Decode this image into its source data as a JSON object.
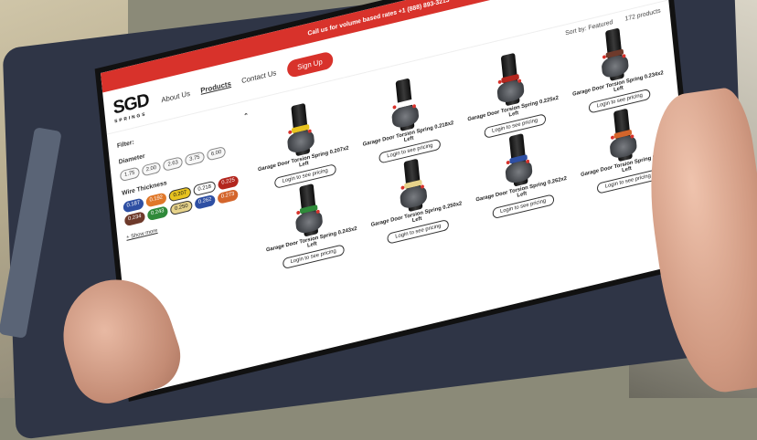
{
  "announcement": "Call us for volume based rates +1 (888) 893-3213 →",
  "brand": {
    "logo_main": "SGD",
    "logo_sub": "SPRINGS"
  },
  "nav": {
    "about": "About Us",
    "products": "Products",
    "contact": "Contact Us",
    "signup": "Sign Up"
  },
  "header_icons": {
    "search": "⌕",
    "account": "♙"
  },
  "sidebar": {
    "filter_title": "Filter:",
    "diameter_title": "Diameter",
    "diameters": [
      "1.75",
      "2.00",
      "2.63",
      "3.75",
      "6.00"
    ],
    "wire_title": "Wire Thickness",
    "wires": [
      {
        "label": "0.187",
        "color": "#2e4fa3"
      },
      {
        "label": "0.192",
        "color": "#e0782a"
      },
      {
        "label": "0.207",
        "color": "#e7c31f"
      },
      {
        "label": "0.218",
        "color": "#ffffff"
      },
      {
        "label": "0.225",
        "color": "#b3261e"
      },
      {
        "label": "0.234",
        "color": "#6e3a2b"
      },
      {
        "label": "0.243",
        "color": "#2f8a3a"
      },
      {
        "label": "0.250",
        "color": "#e6d28a"
      },
      {
        "label": "0.262",
        "color": "#2e4fa3"
      },
      {
        "label": "0.273",
        "color": "#d4652b"
      }
    ],
    "show_more": "+ Show more"
  },
  "main": {
    "sort_label": "Sort by:",
    "sort_value": "Featured",
    "count": "172 products",
    "login_label": "Login to see pricing",
    "products": [
      {
        "title": "Garage Door Torsion Spring 0.207x2 Left",
        "band": "#e7c31f"
      },
      {
        "title": "Garage Door Torsion Spring 0.218x2 Left",
        "band": "#ffffff"
      },
      {
        "title": "Garage Door Torsion Spring 0.225x2 Left",
        "band": "#b3261e"
      },
      {
        "title": "Garage Door Torsion Spring 0.234x2 Left",
        "band": "#6e3a2b"
      },
      {
        "title": "Garage Door Torsion Spring 0.243x2 Left",
        "band": "#2f8a3a"
      },
      {
        "title": "Garage Door Torsion Spring 0.250x2 Left",
        "band": "#e6d28a"
      },
      {
        "title": "Garage Door Torsion Spring 0.262x2 Left",
        "band": "#2e4fa3"
      },
      {
        "title": "Garage Door Torsion Spring 0.273x2 Left",
        "band": "#d4652b"
      }
    ]
  }
}
